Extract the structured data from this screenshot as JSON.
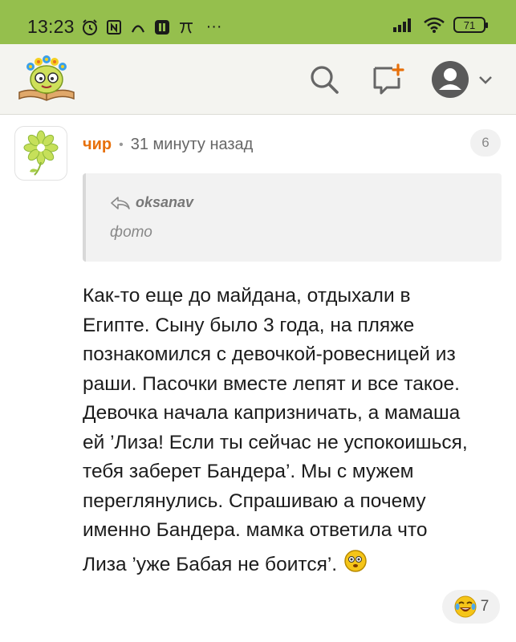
{
  "status_bar": {
    "time": "13:23",
    "battery": "71",
    "more": "···"
  },
  "header": {
    "logo_icon": "book-character-logo",
    "search_icon": "search-icon",
    "new_comment_icon": "add-comment-icon",
    "profile_icon": "user-avatar-icon",
    "accent": "#95bf4d"
  },
  "comment": {
    "author": "чир",
    "separator": "•",
    "time": "31 минуту назад",
    "badge_count": "6",
    "quote": {
      "author": "oksanav",
      "text": "фото"
    },
    "lines": [
      "Как-то еще до майдана, отдыхали в",
      "Египте. Сыну было 3 года, на пляже",
      "познакомился с девочкой-ровесницей из",
      "раши. Пасочки вместе лепят и все такое.",
      "Девочка начала капризничать, а мамаша",
      "ей ’Лиза! Если ты сейчас не успокоишься,",
      "тебя заберет Бандера’. Мы с мужем",
      "переглянулись. Спрашиваю а почему",
      "именно Бандера. мамка ответила что",
      "Лиза ’уже Бабая не боится’."
    ],
    "reaction": {
      "icon": "laughing-emoji-icon",
      "count": "7"
    },
    "author_color": "#e7700b"
  }
}
